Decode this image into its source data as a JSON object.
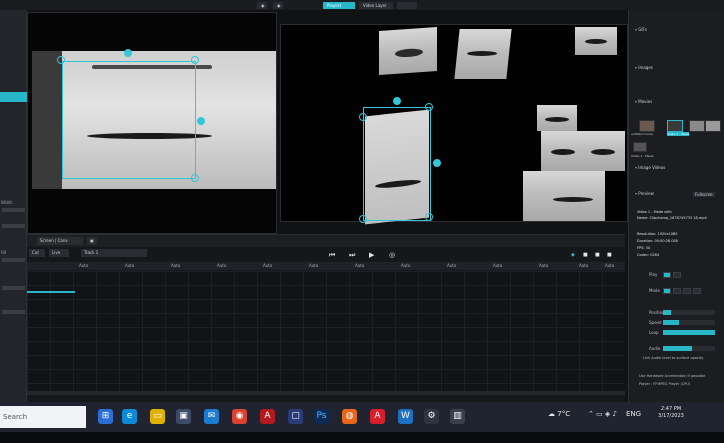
{
  "header": {
    "tabs": [
      {
        "label": "Playlist",
        "active": true
      },
      {
        "label": "Video Layer",
        "active": false
      },
      {
        "label": "",
        "active": false
      }
    ]
  },
  "left_panel": {
    "labels": [
      "Width",
      "Fill"
    ],
    "accent": "#27b7c8"
  },
  "timeline": {
    "toolbar": {
      "mode": "Screen | Canv",
      "item1": "Cut",
      "item2": "Live",
      "track_select": "Track 1"
    },
    "transport": {
      "prev": "⏮",
      "next": "⏭",
      "play": "▶",
      "loop": "◎"
    },
    "track_labels": [
      "Auto",
      "Auto",
      "Auto",
      "Auto",
      "Auto",
      "Auto",
      "Auto",
      "Auto",
      "Auto",
      "Auto",
      "Auto",
      "Auto",
      "Auto"
    ]
  },
  "sidebar": {
    "sections": {
      "gifs": "GIFs",
      "images": "Images",
      "movies": "Movies",
      "image_videos": "Image Videos",
      "preview": "Preview"
    },
    "movie_thumbs": [
      "untitled movie",
      "Video 1 - Made",
      "",
      ""
    ],
    "movie_thumb2": "Video 1 - Made",
    "preview_button": "Fullscree",
    "props": [
      {
        "k": "Video 1 - Made with",
        "v": ""
      },
      {
        "k": "Name:",
        "v": "Clipchamp_1678745733 18.mp4"
      },
      {
        "k": "Resolution:",
        "v": "1920x1080"
      },
      {
        "k": "Duration:",
        "v": "00:00:28.000"
      },
      {
        "k": "FPS:",
        "v": "30"
      },
      {
        "k": "Codec:",
        "v": "h264"
      }
    ],
    "controls": {
      "play": "Play",
      "mode": "Mode",
      "position": "Position",
      "speed": "Speed",
      "loop": "Loop",
      "audio": "Audio",
      "link_audio": "Link Audio level to surface opacity",
      "hw_accel": "Use Hardware Acceleration if possible",
      "player": "Player : FFMPEG Player (CPU)"
    },
    "position_value": 0.15,
    "speed_value": 0.3,
    "audio_value": 0.55
  },
  "taskbar": {
    "search_placeholder": "Search",
    "weather": "7°C",
    "lang": "ENG",
    "time": "2:47 PM",
    "date": "3/17/2023"
  },
  "colors": {
    "accent": "#27b7c8",
    "handle": "#34c6d6",
    "panel": "#1c1d21"
  }
}
